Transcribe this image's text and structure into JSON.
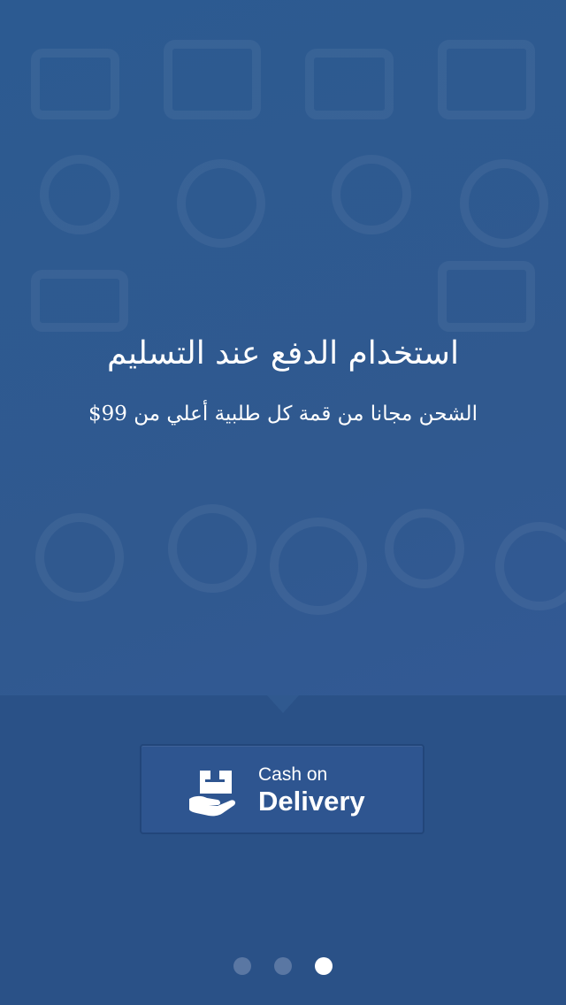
{
  "onboarding": {
    "headline": "استخدام الدفع عند التسليم",
    "subline": "الشحن مجانا من قمة كل طلبية أعلي من 99$",
    "button": {
      "label_small": "Cash on",
      "label_big": "Delivery",
      "icon": "hand-box-icon"
    },
    "pager": {
      "total": 3,
      "active_index": 2
    }
  },
  "colors": {
    "background": "#30598f",
    "bottom_panel": "#2a5187",
    "button_background": "#2e5590",
    "dot_inactive": "#5a77a3",
    "dot_active": "#ffffff",
    "text": "#ffffff"
  }
}
